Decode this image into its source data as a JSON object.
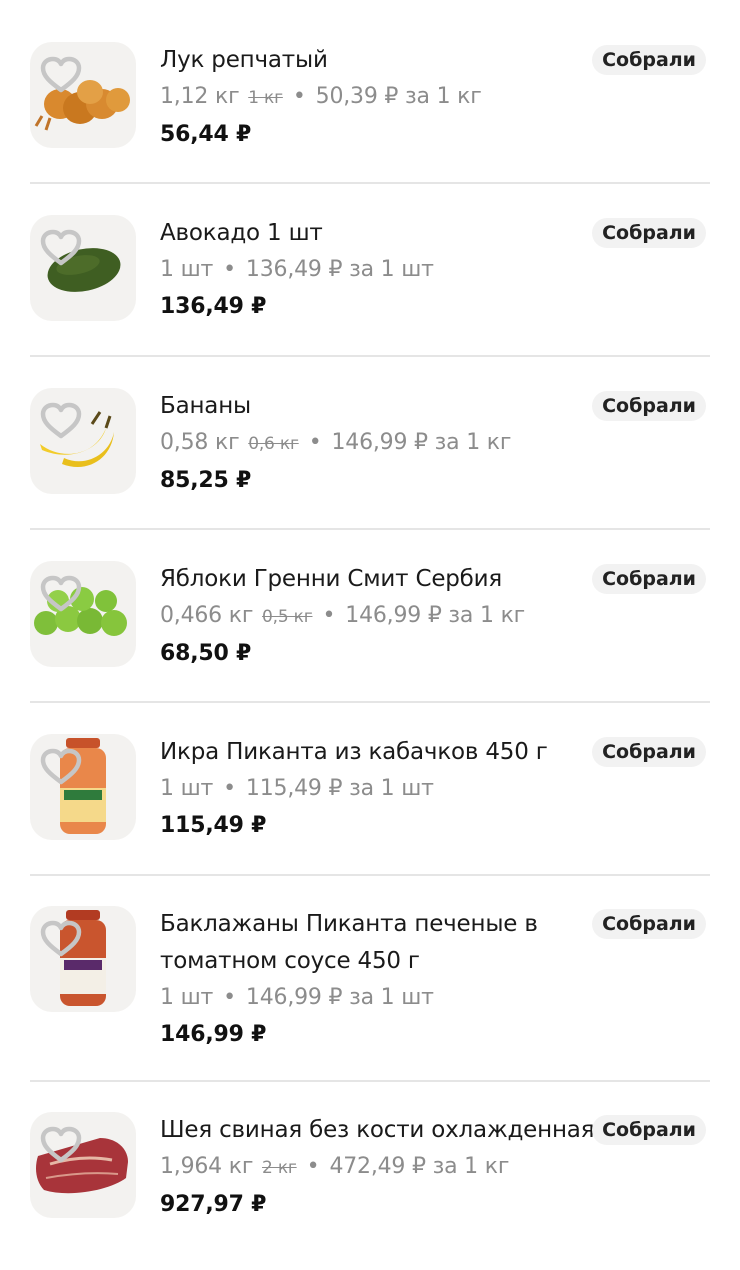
{
  "orders": {
    "items": [
      {
        "name": "Лук репчатый",
        "qty": "1,12 кг",
        "old_qty": "1 кг",
        "unit_price": "50,39 ₽ за 1 кг",
        "total": "56,44 ₽",
        "status": "Собрали",
        "image_icon": "onion-image"
      },
      {
        "name": "Авокадо 1 шт",
        "qty": "1 шт",
        "old_qty": "",
        "unit_price": "136,49 ₽ за 1 шт",
        "total": "136,49 ₽",
        "status": "Собрали",
        "image_icon": "avocado-image"
      },
      {
        "name": "Бананы",
        "qty": "0,58 кг",
        "old_qty": "0,6 кг",
        "unit_price": "146,99 ₽ за 1 кг",
        "total": "85,25 ₽",
        "status": "Собрали",
        "image_icon": "banana-image"
      },
      {
        "name": "Яблоки Гренни Смит Сербия",
        "qty": "0,466 кг",
        "old_qty": "0,5 кг",
        "unit_price": "146,99 ₽ за 1 кг",
        "total": "68,50 ₽",
        "status": "Собрали",
        "image_icon": "apples-image"
      },
      {
        "name": "Икра Пиканта из кабачков 450 г",
        "qty": "1 шт",
        "old_qty": "",
        "unit_price": "115,49 ₽ за 1 шт",
        "total": "115,49 ₽",
        "status": "Собрали",
        "image_icon": "jar-image"
      },
      {
        "name_line1": "Баклажаны Пиканта печеные в",
        "name_line2": "томатном соусе 450 г",
        "qty": "1 шт",
        "old_qty": "",
        "unit_price": "146,99 ₽ за 1 шт",
        "total": "146,99 ₽",
        "status": "Собрали",
        "image_icon": "jar-image"
      },
      {
        "name": "Шея свиная без кости охлажденная",
        "qty": "1,964 кг",
        "old_qty": "2 кг",
        "unit_price": "472,49 ₽ за 1 кг",
        "total": "927,97 ₽",
        "status": "Собрали",
        "image_icon": "meat-image"
      }
    ]
  },
  "icons": {
    "favorite": "heart-outline-icon"
  },
  "colors": {
    "badge_bg": "#f2f2f2",
    "muted_text": "#8c8c8c",
    "divider": "#e5e5e5"
  }
}
